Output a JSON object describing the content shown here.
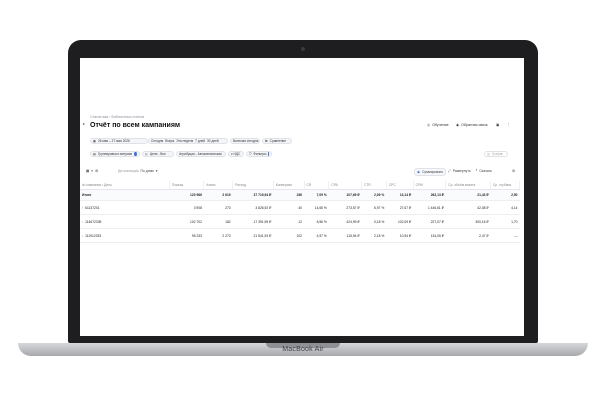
{
  "device": {
    "brand": "MacBook Air"
  },
  "breadcrumb": "Статистика › Библиотека отчётов",
  "page_title": "Отчёт по всем кампаниям",
  "header_actions": {
    "learn": "Обучение",
    "feedback": "Обратная связь"
  },
  "filters_row1": {
    "date_range": "26 мая – 27 мая 2026",
    "quick": [
      "Сегодня",
      "Вчера",
      "Эта неделя",
      "7 дней",
      "30 дней"
    ],
    "include_today": "Включая сегодня",
    "compare": "Сравнение"
  },
  "filters_row2": {
    "grouping": "Группировка и метрики",
    "goals": "Цели - Все",
    "attribution": "Атрибуция - Автоматическая",
    "vat": "с НДС",
    "filters": "Фильтры",
    "chart": "График"
  },
  "toolbar": {
    "detail": "Детализация",
    "detail_value": "По дням",
    "sum": "Суммировать",
    "expand": "Развернуть",
    "download": "Скачать"
  },
  "table": {
    "columns": [
      "№ кампании • День",
      "Показы",
      "Клики",
      "Расход",
      "Конверсии",
      "CR",
      "CPA",
      "CTR",
      "CPC",
      "CPM",
      "Ср. объём визита",
      "Ср. глубина"
    ],
    "total": [
      "Итого",
      "120 966",
      "2 619",
      "37 719,94 ₽",
      "156",
      "7,09 %",
      "107,69 ₽",
      "2,09 %",
      "13,14 ₽",
      "262,13 ₽",
      "21,43 ₽",
      "2,50"
    ],
    "rows": [
      [
        "61137201",
        "3 908",
        "273",
        "3 826,92 ₽",
        "40",
        "14,65 %",
        "273,57 ₽",
        "6,97 %",
        "27,67 ₽",
        "1 446,61 ₽",
        "42,08 ₽",
        "4,14"
      ],
      [
        "114672335",
        "102 702",
        "182",
        "17 391,99 ₽",
        "12",
        "6,56 %",
        "424,99 ₽",
        "0,18 %",
        "102,09 ₽",
        "227,07 ₽",
        "300,16 ₽",
        "1,70"
      ],
      [
        "111912333",
        "95 233",
        "2 273",
        "21 541,93 ₽",
        "102",
        "4,97 %",
        "115,94 ₽",
        "2,18 %",
        "10,94 ₽",
        "134,05 ₽",
        "2,47 ₽",
        "—"
      ]
    ]
  }
}
